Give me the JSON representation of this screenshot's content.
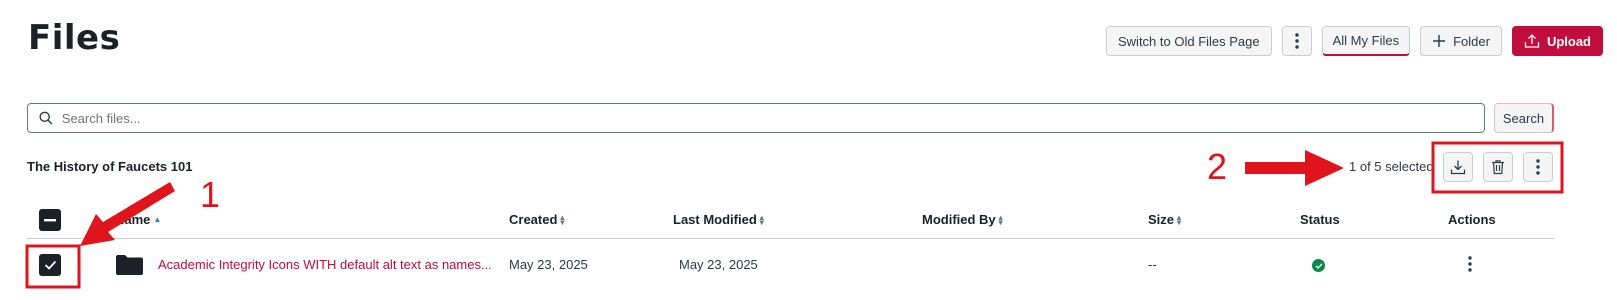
{
  "page": {
    "title": "Files"
  },
  "toolbar": {
    "switch_label": "Switch to Old Files Page",
    "more_icon": "kebab-vertical-icon",
    "all_files_label": "All My Files",
    "folder_label": "Folder",
    "upload_label": "Upload"
  },
  "search": {
    "placeholder": "Search files...",
    "value": "",
    "button_label": "Search"
  },
  "context": {
    "course_name": "The History of Faucets 101",
    "selection_text": "1 of 5 selected"
  },
  "bulk_actions": [
    "download-icon",
    "trash-icon",
    "kebab-vertical-icon"
  ],
  "table": {
    "columns": {
      "name": "Name",
      "created": "Created",
      "modified": "Last Modified",
      "modified_by": "Modified By",
      "size": "Size",
      "status": "Status",
      "actions": "Actions"
    },
    "rows": [
      {
        "checked": true,
        "type": "folder",
        "name": "Academic Integrity Icons WITH default alt text as names...",
        "created": "May 23, 2025",
        "modified": "May 23, 2025",
        "modified_by": "",
        "size": "--",
        "status": "published"
      }
    ]
  },
  "annotations": {
    "label_1": "1",
    "label_2": "2",
    "color": "#e0141c"
  },
  "colors": {
    "brand": "#c00d3d",
    "status_ok": "#0b874b",
    "sort_active": "#2b7abc"
  }
}
